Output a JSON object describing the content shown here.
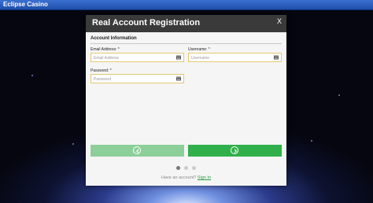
{
  "app": {
    "title": "Eclipse Casino"
  },
  "modal": {
    "title": "Real Account Registration",
    "close_label": "X",
    "section_title": "Account Information",
    "fields": {
      "email": {
        "label": "Email Address: *",
        "placeholder": "Email Address"
      },
      "username": {
        "label": "Username: *",
        "placeholder": "Username"
      },
      "password": {
        "label": "Password: *",
        "placeholder": "Password"
      }
    },
    "pagination": {
      "total": 3,
      "current": 1
    },
    "footer": {
      "text": "Have an account?",
      "link": "Sign In"
    }
  },
  "colors": {
    "header": "#3a3a3a",
    "next_button": "#30b04a",
    "prev_button_disabled": "#8ccf98",
    "field_border": "#e5c870",
    "link": "#2e9a3e"
  },
  "icons": {
    "field_icon": "keyboard-icon",
    "prev": "chevron-left-icon",
    "next": "chevron-right-icon"
  }
}
